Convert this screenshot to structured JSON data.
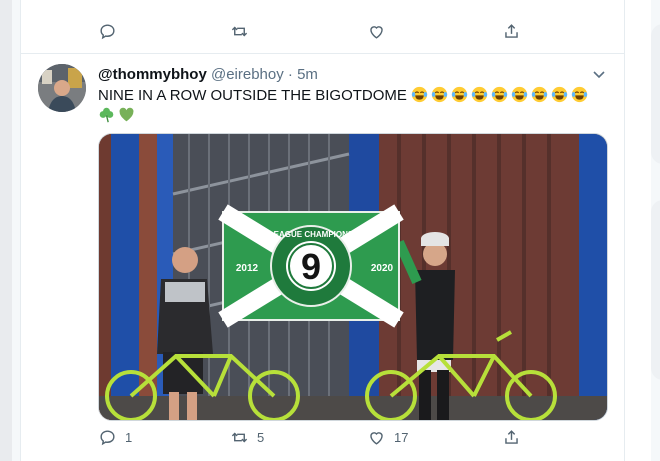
{
  "top_actions": {
    "reply_count": "",
    "retweet_count": "",
    "like_count": ""
  },
  "tweet": {
    "display_name": "@thommybhoy",
    "handle": "@eirebhoy",
    "separator": "·",
    "time": "5m",
    "text": "NINE IN A ROW OUTSIDE THE BIGOTDOME",
    "emojis": [
      "joy-emoji",
      "joy-emoji",
      "joy-emoji",
      "joy-emoji",
      "joy-emoji",
      "joy-emoji",
      "joy-emoji",
      "joy-emoji",
      "joy-emoji",
      "shamrock-emoji",
      "green-heart-emoji"
    ],
    "media": {
      "flag": {
        "center": "9",
        "year_left": "2012",
        "year_right": "2020",
        "ring_text": "LEAGUE CHAMPIONS"
      }
    },
    "actions": {
      "reply_count": "1",
      "retweet_count": "5",
      "like_count": "17"
    }
  },
  "colors": {
    "icon_gray": "#536471",
    "divider": "#e6ecf0",
    "flag_green": "#2e9b4f"
  }
}
